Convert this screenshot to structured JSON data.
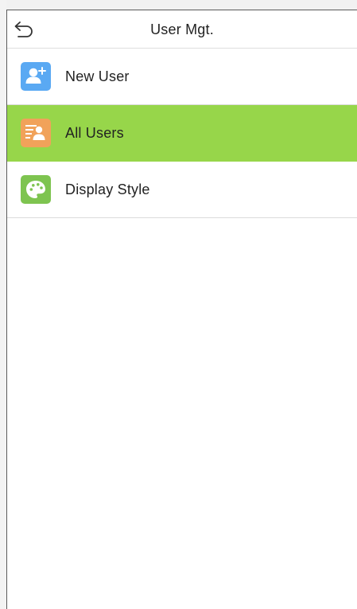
{
  "header": {
    "title": "User Mgt.",
    "back_icon": "back-arrow-icon"
  },
  "menu": {
    "items": [
      {
        "label": "New User",
        "icon": "add-user-icon",
        "icon_color": "#5aa9f3",
        "selected": false
      },
      {
        "label": "All Users",
        "icon": "user-list-icon",
        "icon_color": "#f1a25a",
        "selected": true
      },
      {
        "label": "Display Style",
        "icon": "palette-icon",
        "icon_color": "#7ec450",
        "selected": false
      }
    ]
  },
  "colors": {
    "selected_row": "#97d64a",
    "background": "#ffffff",
    "divider": "#dcdcdc"
  }
}
